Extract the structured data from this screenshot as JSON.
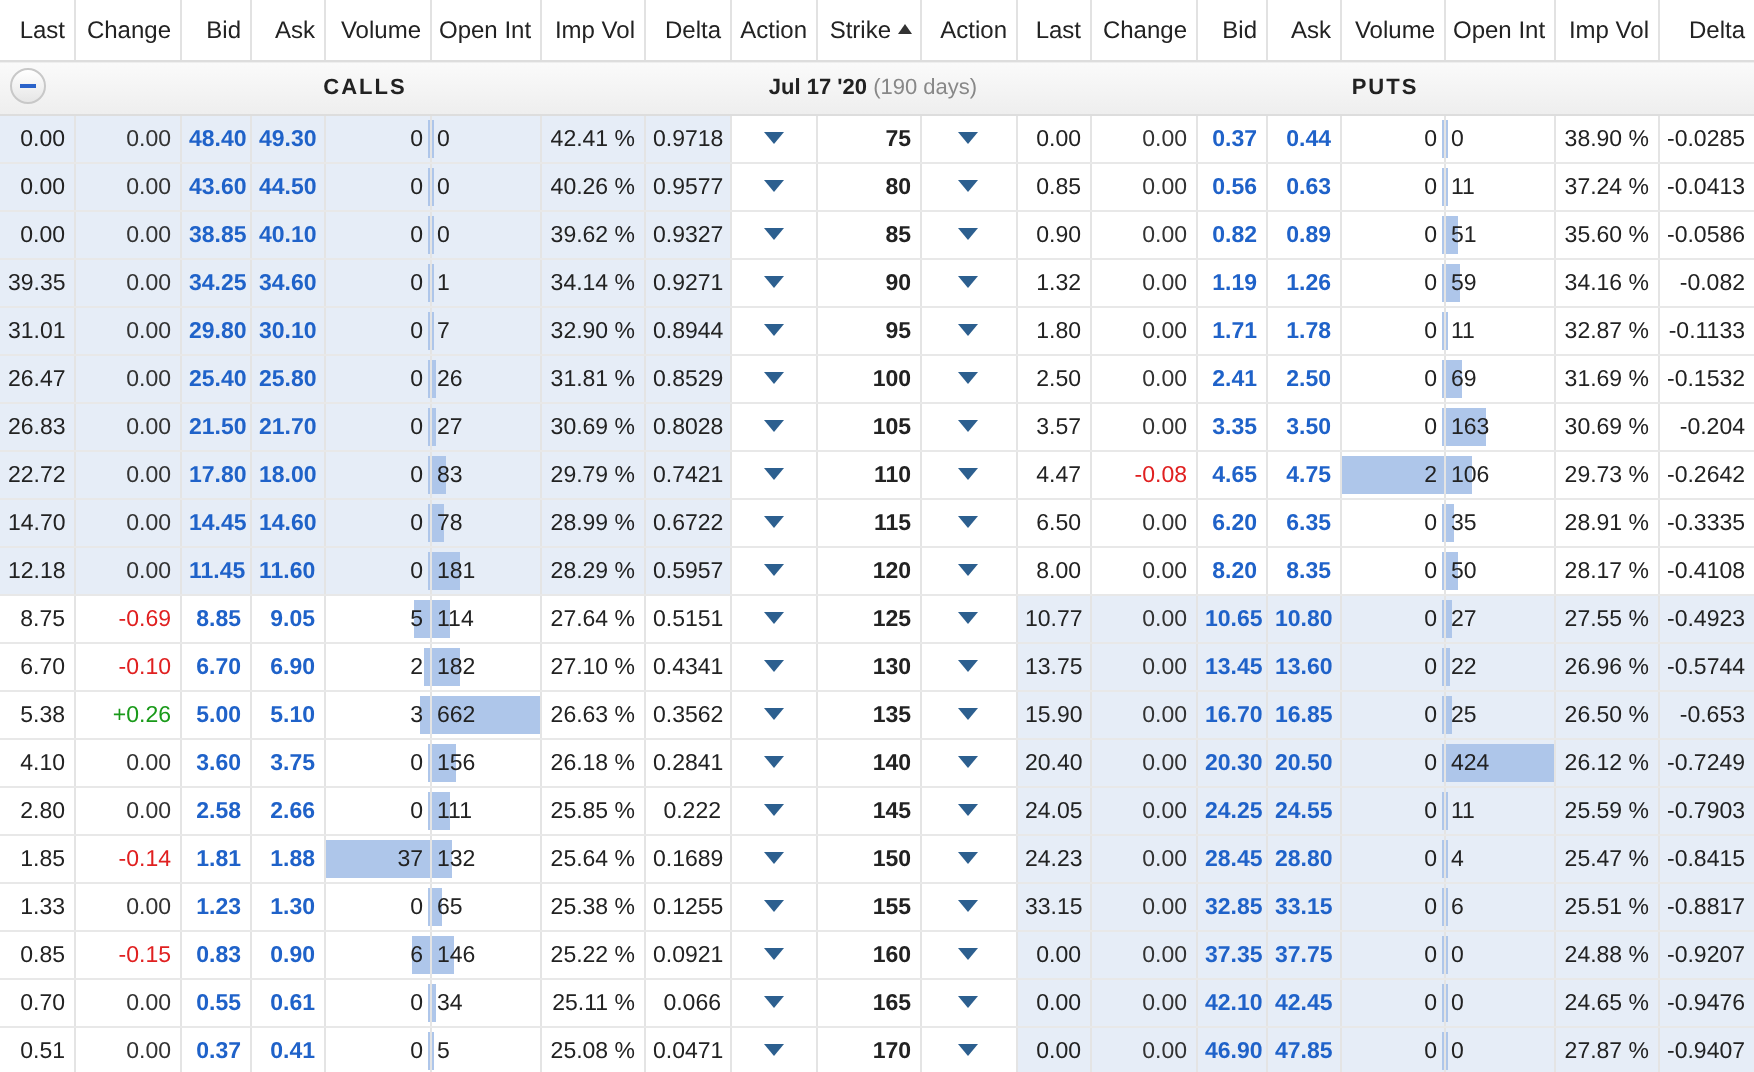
{
  "columns": [
    {
      "label": "Last",
      "sorted": false
    },
    {
      "label": "Change",
      "sorted": false
    },
    {
      "label": "Bid",
      "sorted": false
    },
    {
      "label": "Ask",
      "sorted": false
    },
    {
      "label": "Volume",
      "sorted": false
    },
    {
      "label": "Open Int",
      "sorted": false
    },
    {
      "label": "Imp Vol",
      "sorted": false
    },
    {
      "label": "Delta",
      "sorted": false
    },
    {
      "label": "Action",
      "sorted": false
    },
    {
      "label": "Strike",
      "sorted": true
    },
    {
      "label": "Action",
      "sorted": false
    },
    {
      "label": "Last",
      "sorted": false
    },
    {
      "label": "Change",
      "sorted": false
    },
    {
      "label": "Bid",
      "sorted": false
    },
    {
      "label": "Ask",
      "sorted": false
    },
    {
      "label": "Volume",
      "sorted": false
    },
    {
      "label": "Open Int",
      "sorted": false
    },
    {
      "label": "Imp Vol",
      "sorted": false
    },
    {
      "label": "Delta",
      "sorted": false
    }
  ],
  "section": {
    "expanded": true,
    "calls_label": "CALLS",
    "expiry": "Jul 17 '20",
    "days": "(190 days)",
    "puts_label": "PUTS"
  },
  "rows": [
    {
      "strike": "75",
      "calls": {
        "in_the_money": true,
        "last": "0.00",
        "change": {
          "text": "0.00",
          "color": "#333333"
        },
        "bid": "48.40",
        "ask": "49.30",
        "volume": {
          "value": "0",
          "level": 0
        },
        "open_int": {
          "value": "0",
          "level": 0
        },
        "imp_vol": "42.41 %",
        "delta": "0.9718"
      },
      "puts": {
        "in_the_money": false,
        "last": "0.00",
        "change": {
          "text": "0.00",
          "color": "#333333"
        },
        "bid": "0.37",
        "ask": "0.44",
        "volume": {
          "value": "0",
          "level": 0
        },
        "open_int": {
          "value": "0",
          "level": 0
        },
        "imp_vol": "38.90 %",
        "delta": "-0.0285"
      }
    },
    {
      "strike": "80",
      "calls": {
        "in_the_money": true,
        "last": "0.00",
        "change": {
          "text": "0.00",
          "color": "#333333"
        },
        "bid": "43.60",
        "ask": "44.50",
        "volume": {
          "value": "0",
          "level": 0
        },
        "open_int": {
          "value": "0",
          "level": 0
        },
        "imp_vol": "40.26 %",
        "delta": "0.9577"
      },
      "puts": {
        "in_the_money": false,
        "last": "0.85",
        "change": {
          "text": "0.00",
          "color": "#333333"
        },
        "bid": "0.56",
        "ask": "0.63",
        "volume": {
          "value": "0",
          "level": 0
        },
        "open_int": {
          "value": "11",
          "level": 0.03
        },
        "imp_vol": "37.24 %",
        "delta": "-0.0413"
      }
    },
    {
      "strike": "85",
      "calls": {
        "in_the_money": true,
        "last": "0.00",
        "change": {
          "text": "0.00",
          "color": "#333333"
        },
        "bid": "38.85",
        "ask": "40.10",
        "volume": {
          "value": "0",
          "level": 0
        },
        "open_int": {
          "value": "0",
          "level": 0
        },
        "imp_vol": "39.62 %",
        "delta": "0.9327"
      },
      "puts": {
        "in_the_money": false,
        "last": "0.90",
        "change": {
          "text": "0.00",
          "color": "#333333"
        },
        "bid": "0.82",
        "ask": "0.89",
        "volume": {
          "value": "0",
          "level": 0
        },
        "open_int": {
          "value": "51",
          "level": 0.12
        },
        "imp_vol": "35.60 %",
        "delta": "-0.0586"
      }
    },
    {
      "strike": "90",
      "calls": {
        "in_the_money": true,
        "last": "39.35",
        "change": {
          "text": "0.00",
          "color": "#333333"
        },
        "bid": "34.25",
        "ask": "34.60",
        "volume": {
          "value": "0",
          "level": 0
        },
        "open_int": {
          "value": "1",
          "level": 0.002
        },
        "imp_vol": "34.14 %",
        "delta": "0.9271"
      },
      "puts": {
        "in_the_money": false,
        "last": "1.32",
        "change": {
          "text": "0.00",
          "color": "#333333"
        },
        "bid": "1.19",
        "ask": "1.26",
        "volume": {
          "value": "0",
          "level": 0
        },
        "open_int": {
          "value": "59",
          "level": 0.14
        },
        "imp_vol": "34.16 %",
        "delta": "-0.082"
      }
    },
    {
      "strike": "95",
      "calls": {
        "in_the_money": true,
        "last": "31.01",
        "change": {
          "text": "0.00",
          "color": "#333333"
        },
        "bid": "29.80",
        "ask": "30.10",
        "volume": {
          "value": "0",
          "level": 0
        },
        "open_int": {
          "value": "7",
          "level": 0.01
        },
        "imp_vol": "32.90 %",
        "delta": "0.8944"
      },
      "puts": {
        "in_the_money": false,
        "last": "1.80",
        "change": {
          "text": "0.00",
          "color": "#333333"
        },
        "bid": "1.71",
        "ask": "1.78",
        "volume": {
          "value": "0",
          "level": 0
        },
        "open_int": {
          "value": "11",
          "level": 0.03
        },
        "imp_vol": "32.87 %",
        "delta": "-0.1133"
      }
    },
    {
      "strike": "100",
      "calls": {
        "in_the_money": true,
        "last": "26.47",
        "change": {
          "text": "0.00",
          "color": "#333333"
        },
        "bid": "25.40",
        "ask": "25.80",
        "volume": {
          "value": "0",
          "level": 0
        },
        "open_int": {
          "value": "26",
          "level": 0.04
        },
        "imp_vol": "31.81 %",
        "delta": "0.8529"
      },
      "puts": {
        "in_the_money": false,
        "last": "2.50",
        "change": {
          "text": "0.00",
          "color": "#333333"
        },
        "bid": "2.41",
        "ask": "2.50",
        "volume": {
          "value": "0",
          "level": 0
        },
        "open_int": {
          "value": "69",
          "level": 0.16
        },
        "imp_vol": "31.69 %",
        "delta": "-0.1532"
      }
    },
    {
      "strike": "105",
      "calls": {
        "in_the_money": true,
        "last": "26.83",
        "change": {
          "text": "0.00",
          "color": "#333333"
        },
        "bid": "21.50",
        "ask": "21.70",
        "volume": {
          "value": "0",
          "level": 0
        },
        "open_int": {
          "value": "27",
          "level": 0.04
        },
        "imp_vol": "30.69 %",
        "delta": "0.8028"
      },
      "puts": {
        "in_the_money": false,
        "last": "3.57",
        "change": {
          "text": "0.00",
          "color": "#333333"
        },
        "bid": "3.35",
        "ask": "3.50",
        "volume": {
          "value": "0",
          "level": 0
        },
        "open_int": {
          "value": "163",
          "level": 0.38
        },
        "imp_vol": "30.69 %",
        "delta": "-0.204"
      }
    },
    {
      "strike": "110",
      "calls": {
        "in_the_money": true,
        "last": "22.72",
        "change": {
          "text": "0.00",
          "color": "#333333"
        },
        "bid": "17.80",
        "ask": "18.00",
        "volume": {
          "value": "0",
          "level": 0
        },
        "open_int": {
          "value": "83",
          "level": 0.13
        },
        "imp_vol": "29.79 %",
        "delta": "0.7421"
      },
      "puts": {
        "in_the_money": false,
        "last": "4.47",
        "change": {
          "text": "-0.08",
          "color": "#e02020"
        },
        "bid": "4.65",
        "ask": "4.75",
        "volume": {
          "value": "2",
          "level": 1
        },
        "open_int": {
          "value": "106",
          "level": 0.25
        },
        "imp_vol": "29.73 %",
        "delta": "-0.2642"
      }
    },
    {
      "strike": "115",
      "calls": {
        "in_the_money": true,
        "last": "14.70",
        "change": {
          "text": "0.00",
          "color": "#333333"
        },
        "bid": "14.45",
        "ask": "14.60",
        "volume": {
          "value": "0",
          "level": 0
        },
        "open_int": {
          "value": "78",
          "level": 0.12
        },
        "imp_vol": "28.99 %",
        "delta": "0.6722"
      },
      "puts": {
        "in_the_money": false,
        "last": "6.50",
        "change": {
          "text": "0.00",
          "color": "#333333"
        },
        "bid": "6.20",
        "ask": "6.35",
        "volume": {
          "value": "0",
          "level": 0
        },
        "open_int": {
          "value": "35",
          "level": 0.08
        },
        "imp_vol": "28.91 %",
        "delta": "-0.3335"
      }
    },
    {
      "strike": "120",
      "calls": {
        "in_the_money": true,
        "last": "12.18",
        "change": {
          "text": "0.00",
          "color": "#333333"
        },
        "bid": "11.45",
        "ask": "11.60",
        "volume": {
          "value": "0",
          "level": 0
        },
        "open_int": {
          "value": "181",
          "level": 0.27
        },
        "imp_vol": "28.29 %",
        "delta": "0.5957"
      },
      "puts": {
        "in_the_money": false,
        "last": "8.00",
        "change": {
          "text": "0.00",
          "color": "#333333"
        },
        "bid": "8.20",
        "ask": "8.35",
        "volume": {
          "value": "0",
          "level": 0
        },
        "open_int": {
          "value": "50",
          "level": 0.12
        },
        "imp_vol": "28.17 %",
        "delta": "-0.4108"
      }
    },
    {
      "strike": "125",
      "calls": {
        "in_the_money": false,
        "last": "8.75",
        "change": {
          "text": "-0.69",
          "color": "#e02020"
        },
        "bid": "8.85",
        "ask": "9.05",
        "volume": {
          "value": "5",
          "level": 0.14
        },
        "open_int": {
          "value": "114",
          "level": 0.17
        },
        "imp_vol": "27.64 %",
        "delta": "0.5151"
      },
      "puts": {
        "in_the_money": true,
        "last": "10.77",
        "change": {
          "text": "0.00",
          "color": "#333333"
        },
        "bid": "10.65",
        "ask": "10.80",
        "volume": {
          "value": "0",
          "level": 0
        },
        "open_int": {
          "value": "27",
          "level": 0.06
        },
        "imp_vol": "27.55 %",
        "delta": "-0.4923"
      }
    },
    {
      "strike": "130",
      "calls": {
        "in_the_money": false,
        "last": "6.70",
        "change": {
          "text": "-0.10",
          "color": "#e02020"
        },
        "bid": "6.70",
        "ask": "6.90",
        "volume": {
          "value": "2",
          "level": 0.05
        },
        "open_int": {
          "value": "182",
          "level": 0.27
        },
        "imp_vol": "27.10 %",
        "delta": "0.4341"
      },
      "puts": {
        "in_the_money": true,
        "last": "13.75",
        "change": {
          "text": "0.00",
          "color": "#333333"
        },
        "bid": "13.45",
        "ask": "13.60",
        "volume": {
          "value": "0",
          "level": 0
        },
        "open_int": {
          "value": "22",
          "level": 0.05
        },
        "imp_vol": "26.96 %",
        "delta": "-0.5744"
      }
    },
    {
      "strike": "135",
      "calls": {
        "in_the_money": false,
        "last": "5.38",
        "change": {
          "text": "+0.26",
          "color": "#1a9a1a"
        },
        "bid": "5.00",
        "ask": "5.10",
        "volume": {
          "value": "3",
          "level": 0.08
        },
        "open_int": {
          "value": "662",
          "level": 1
        },
        "imp_vol": "26.63 %",
        "delta": "0.3562"
      },
      "puts": {
        "in_the_money": true,
        "last": "15.90",
        "change": {
          "text": "0.00",
          "color": "#333333"
        },
        "bid": "16.70",
        "ask": "16.85",
        "volume": {
          "value": "0",
          "level": 0
        },
        "open_int": {
          "value": "25",
          "level": 0.06
        },
        "imp_vol": "26.50 %",
        "delta": "-0.653"
      }
    },
    {
      "strike": "140",
      "calls": {
        "in_the_money": false,
        "last": "4.10",
        "change": {
          "text": "0.00",
          "color": "#333333"
        },
        "bid": "3.60",
        "ask": "3.75",
        "volume": {
          "value": "0",
          "level": 0
        },
        "open_int": {
          "value": "156",
          "level": 0.24
        },
        "imp_vol": "26.18 %",
        "delta": "0.2841"
      },
      "puts": {
        "in_the_money": true,
        "last": "20.40",
        "change": {
          "text": "0.00",
          "color": "#333333"
        },
        "bid": "20.30",
        "ask": "20.50",
        "volume": {
          "value": "0",
          "level": 0
        },
        "open_int": {
          "value": "424",
          "level": 1
        },
        "imp_vol": "26.12 %",
        "delta": "-0.7249"
      }
    },
    {
      "strike": "145",
      "calls": {
        "in_the_money": false,
        "last": "2.80",
        "change": {
          "text": "0.00",
          "color": "#333333"
        },
        "bid": "2.58",
        "ask": "2.66",
        "volume": {
          "value": "0",
          "level": 0
        },
        "open_int": {
          "value": "111",
          "level": 0.17
        },
        "imp_vol": "25.85 %",
        "delta": "0.222"
      },
      "puts": {
        "in_the_money": true,
        "last": "24.05",
        "change": {
          "text": "0.00",
          "color": "#333333"
        },
        "bid": "24.25",
        "ask": "24.55",
        "volume": {
          "value": "0",
          "level": 0
        },
        "open_int": {
          "value": "11",
          "level": 0.03
        },
        "imp_vol": "25.59 %",
        "delta": "-0.7903"
      }
    },
    {
      "strike": "150",
      "calls": {
        "in_the_money": false,
        "last": "1.85",
        "change": {
          "text": "-0.14",
          "color": "#e02020"
        },
        "bid": "1.81",
        "ask": "1.88",
        "volume": {
          "value": "37",
          "level": 1
        },
        "open_int": {
          "value": "132",
          "level": 0.2
        },
        "imp_vol": "25.64 %",
        "delta": "0.1689"
      },
      "puts": {
        "in_the_money": true,
        "last": "24.23",
        "change": {
          "text": "0.00",
          "color": "#333333"
        },
        "bid": "28.45",
        "ask": "28.80",
        "volume": {
          "value": "0",
          "level": 0
        },
        "open_int": {
          "value": "4",
          "level": 0.01
        },
        "imp_vol": "25.47 %",
        "delta": "-0.8415"
      }
    },
    {
      "strike": "155",
      "calls": {
        "in_the_money": false,
        "last": "1.33",
        "change": {
          "text": "0.00",
          "color": "#333333"
        },
        "bid": "1.23",
        "ask": "1.30",
        "volume": {
          "value": "0",
          "level": 0
        },
        "open_int": {
          "value": "65",
          "level": 0.1
        },
        "imp_vol": "25.38 %",
        "delta": "0.1255"
      },
      "puts": {
        "in_the_money": true,
        "last": "33.15",
        "change": {
          "text": "0.00",
          "color": "#333333"
        },
        "bid": "32.85",
        "ask": "33.15",
        "volume": {
          "value": "0",
          "level": 0
        },
        "open_int": {
          "value": "6",
          "level": 0.01
        },
        "imp_vol": "25.51 %",
        "delta": "-0.8817"
      }
    },
    {
      "strike": "160",
      "calls": {
        "in_the_money": false,
        "last": "0.85",
        "change": {
          "text": "-0.15",
          "color": "#e02020"
        },
        "bid": "0.83",
        "ask": "0.90",
        "volume": {
          "value": "6",
          "level": 0.16
        },
        "open_int": {
          "value": "146",
          "level": 0.22
        },
        "imp_vol": "25.22 %",
        "delta": "0.0921"
      },
      "puts": {
        "in_the_money": true,
        "last": "0.00",
        "change": {
          "text": "0.00",
          "color": "#333333"
        },
        "bid": "37.35",
        "ask": "37.75",
        "volume": {
          "value": "0",
          "level": 0
        },
        "open_int": {
          "value": "0",
          "level": 0
        },
        "imp_vol": "24.88 %",
        "delta": "-0.9207"
      }
    },
    {
      "strike": "165",
      "calls": {
        "in_the_money": false,
        "last": "0.70",
        "change": {
          "text": "0.00",
          "color": "#333333"
        },
        "bid": "0.55",
        "ask": "0.61",
        "volume": {
          "value": "0",
          "level": 0
        },
        "open_int": {
          "value": "34",
          "level": 0.05
        },
        "imp_vol": "25.11 %",
        "delta": "0.066"
      },
      "puts": {
        "in_the_money": true,
        "last": "0.00",
        "change": {
          "text": "0.00",
          "color": "#333333"
        },
        "bid": "42.10",
        "ask": "42.45",
        "volume": {
          "value": "0",
          "level": 0
        },
        "open_int": {
          "value": "0",
          "level": 0
        },
        "imp_vol": "24.65 %",
        "delta": "-0.9476"
      }
    },
    {
      "strike": "170",
      "calls": {
        "in_the_money": false,
        "last": "0.51",
        "change": {
          "text": "0.00",
          "color": "#333333"
        },
        "bid": "0.37",
        "ask": "0.41",
        "volume": {
          "value": "0",
          "level": 0
        },
        "open_int": {
          "value": "5",
          "level": 0.01
        },
        "imp_vol": "25.08 %",
        "delta": "0.0471"
      },
      "puts": {
        "in_the_money": true,
        "last": "0.00",
        "change": {
          "text": "0.00",
          "color": "#333333"
        },
        "bid": "46.90",
        "ask": "47.85",
        "volume": {
          "value": "0",
          "level": 0
        },
        "open_int": {
          "value": "0",
          "level": 0
        },
        "imp_vol": "27.87 %",
        "delta": "-0.9407"
      }
    }
  ]
}
